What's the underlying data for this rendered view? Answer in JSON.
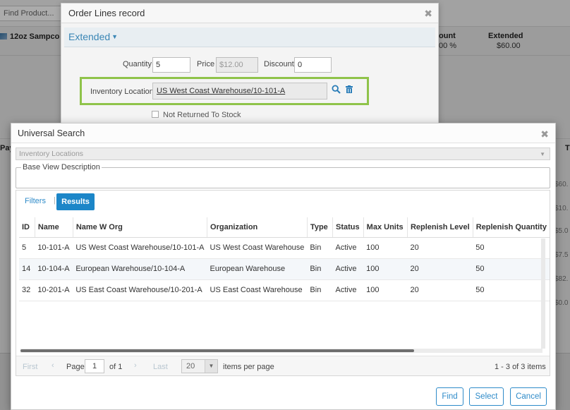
{
  "background": {
    "find_product_placeholder": "Find Product...",
    "product_name": "12oz Sampco I",
    "columns": [
      {
        "header": "ount",
        "value": "00 %"
      },
      {
        "header": "Extended",
        "value": "$60.00"
      }
    ],
    "payment_label": "Pay",
    "total_label": "T",
    "right_values": [
      "$60.",
      "$10.",
      "$5.0",
      "$7.5",
      "$82.",
      "$0.0"
    ]
  },
  "order_modal": {
    "title": "Order Lines record",
    "tab_label": "Extended",
    "quantity_label": "Quantity",
    "quantity_value": "5",
    "price_label": "Price",
    "price_value": "$12.00",
    "discount_label": "Discount",
    "discount_value": "0",
    "inventory_location_label": "Inventory Location",
    "inventory_location_value": "US West Coast Warehouse/10-101-A",
    "not_returned_label": "Not Returned To Stock"
  },
  "search_modal": {
    "title": "Universal Search",
    "entity_select": "Inventory Locations",
    "base_view_legend": "Base View Description",
    "tabs": {
      "filters": "Filters",
      "results": "Results"
    },
    "columns": [
      "ID",
      "Name",
      "Name W Org",
      "Organization",
      "Type",
      "Status",
      "Max Units",
      "Replenish Level",
      "Replenish Quantity"
    ],
    "rows": [
      [
        "5",
        "10-101-A",
        "US West Coast Warehouse/10-101-A",
        "US West Coast Warehouse",
        "Bin",
        "Active",
        "100",
        "20",
        "50"
      ],
      [
        "14",
        "10-104-A",
        "European Warehouse/10-104-A",
        "European Warehouse",
        "Bin",
        "Active",
        "100",
        "20",
        "50"
      ],
      [
        "32",
        "10-201-A",
        "US East Coast Warehouse/10-201-A",
        "US East Coast Warehouse",
        "Bin",
        "Active",
        "100",
        "20",
        "50"
      ]
    ],
    "pager": {
      "first": "First",
      "prev": "‹",
      "page_label": "Page",
      "page_value": "1",
      "of_label": "of 1",
      "next": "›",
      "last": "Last",
      "page_size": "20",
      "items_per_page": "items per page",
      "range": "1 - 3 of 3 items"
    },
    "buttons": {
      "find": "Find",
      "select": "Select",
      "cancel": "Cancel"
    }
  },
  "colors": {
    "accent": "#2e8bc9",
    "highlight_border": "#8fc34a"
  }
}
